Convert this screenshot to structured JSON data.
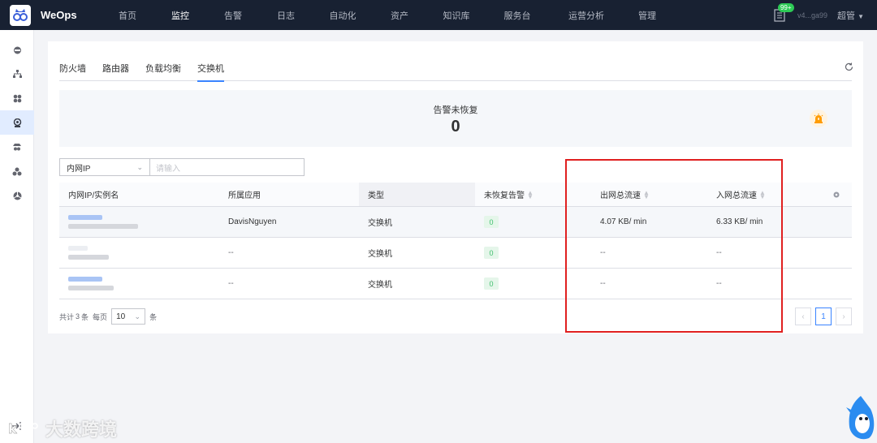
{
  "app": {
    "brand": "WeOps",
    "version": "v4...ga99",
    "user": "超管",
    "badge": "99+"
  },
  "nav": [
    {
      "label": "首页",
      "active": false
    },
    {
      "label": "监控",
      "active": true
    },
    {
      "label": "告警",
      "active": false
    },
    {
      "label": "日志",
      "active": false
    },
    {
      "label": "自动化",
      "active": false
    },
    {
      "label": "资产",
      "active": false
    },
    {
      "label": "知识库",
      "active": false
    },
    {
      "label": "服务台",
      "active": false
    },
    {
      "label": "运营分析",
      "active": false
    },
    {
      "label": "管理",
      "active": false
    }
  ],
  "tabs": {
    "firewall": "防火墙",
    "router": "路由器",
    "loadbalancer": "负载均衡",
    "switch": "交换机"
  },
  "alert": {
    "title": "告警未恢复",
    "count": "0"
  },
  "filter": {
    "field": "内网IP",
    "placeholder": "请输入"
  },
  "table": {
    "headers": {
      "ip": "内网IP/实例名",
      "app": "所属应用",
      "type": "类型",
      "unresolved": "未恢复告警",
      "out_traffic": "出网总流速",
      "in_traffic": "入网总流速"
    },
    "rows": [
      {
        "app": "DavisNguyen",
        "type": "交换机",
        "unresolved": "0",
        "out": "4.07 KB/ min",
        "in": "6.33 KB/ min"
      },
      {
        "app": "--",
        "type": "交换机",
        "unresolved": "0",
        "out": "--",
        "in": "--"
      },
      {
        "app": "--",
        "type": "交换机",
        "unresolved": "0",
        "out": "--",
        "in": "--"
      }
    ]
  },
  "footer": {
    "total_prefix": "共计",
    "total": "3",
    "total_suffix": "条",
    "per_page_label": "每页",
    "per_page": "10",
    "unit": "条",
    "page": "1"
  },
  "watermark": "大数跨境",
  "colors": {
    "nav_bg": "#182132",
    "primary": "#3a84ff",
    "highlight": "#e02020",
    "success": "#3fc06d"
  }
}
